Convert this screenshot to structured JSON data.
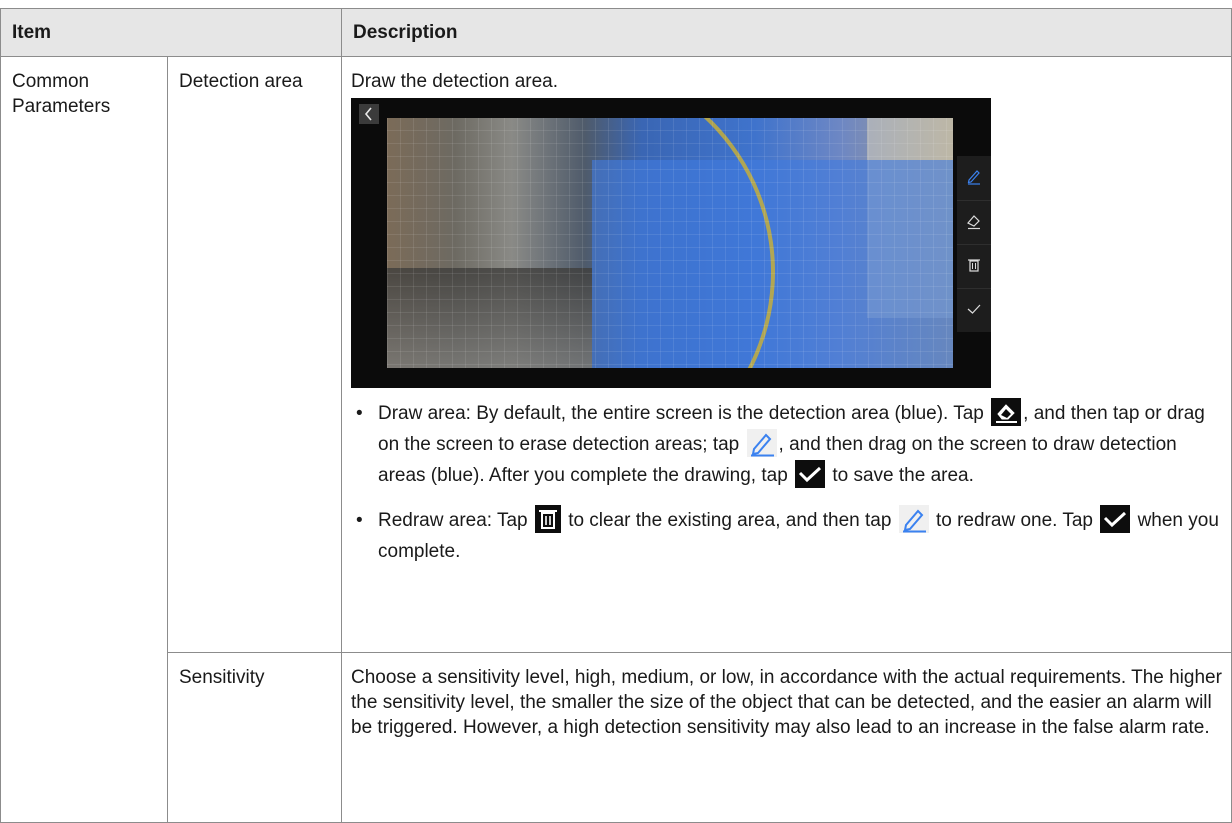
{
  "table": {
    "header": {
      "item": "Item",
      "description": "Description"
    },
    "group_label": "Common Parameters",
    "rows": [
      {
        "sub_item": "Detection area",
        "intro": "Draw the detection area.",
        "bullets": [
          {
            "p1": "Draw area: By default, the entire screen is the detection area (blue). Tap",
            "p2": ", and then tap or drag on the screen to erase detection areas; tap",
            "p3": ", and then drag on the screen to draw detection areas (blue). After you complete the drawing, tap",
            "p4": "to save the area."
          },
          {
            "p1": "Redraw area: Tap",
            "p2": "to clear the existing area, and then tap",
            "p3": "to redraw one. Tap",
            "p4": "when you complete."
          }
        ]
      },
      {
        "sub_item": "Sensitivity",
        "text": "Choose a sensitivity level, high, medium, or low, in accordance with the actual requirements. The higher the sensitivity level, the smaller the size of the object that can be detected, and the easier an alarm will be triggered. However, a high detection sensitivity may also lead to an increase in the false alarm rate."
      }
    ]
  },
  "icons": {
    "back": "chevron-left-icon",
    "pen": "pen-icon",
    "eraser": "eraser-icon",
    "trash": "trash-icon",
    "check": "checkmark-icon"
  },
  "colors": {
    "header_bg": "#e6e6e6",
    "border": "#8c8c8c",
    "pen_blue": "#3b82f0",
    "overlay_blue": "#407ade"
  }
}
